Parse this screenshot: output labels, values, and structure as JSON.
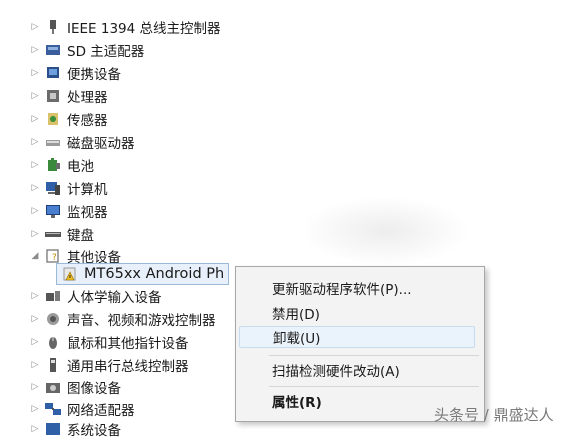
{
  "tree": {
    "items": [
      {
        "label": "IEEE 1394 总线主控制器",
        "icon": "ieee1394-icon"
      },
      {
        "label": "SD 主适配器",
        "icon": "sd-host-icon"
      },
      {
        "label": "便携设备",
        "icon": "portable-device-icon"
      },
      {
        "label": "处理器",
        "icon": "processor-icon"
      },
      {
        "label": "传感器",
        "icon": "sensor-icon"
      },
      {
        "label": "磁盘驱动器",
        "icon": "disk-drive-icon"
      },
      {
        "label": "电池",
        "icon": "battery-icon"
      },
      {
        "label": "计算机",
        "icon": "computer-icon"
      },
      {
        "label": "监视器",
        "icon": "monitor-icon"
      },
      {
        "label": "键盘",
        "icon": "keyboard-icon"
      },
      {
        "label": "其他设备",
        "icon": "other-devices-icon"
      },
      {
        "label": "人体学输入设备",
        "icon": "hid-icon"
      },
      {
        "label": "声音、视频和游戏控制器",
        "icon": "sound-icon"
      },
      {
        "label": "鼠标和其他指针设备",
        "icon": "mouse-icon"
      },
      {
        "label": "通用串行总线控制器",
        "icon": "usb-icon"
      },
      {
        "label": "图像设备",
        "icon": "imaging-icon"
      },
      {
        "label": "网络适配器",
        "icon": "network-icon"
      },
      {
        "label": "系统设备",
        "icon": "system-icon"
      }
    ],
    "selected_child": {
      "label": "MT65xx Android Ph",
      "icon": "warning-device-icon"
    }
  },
  "context_menu": {
    "update_driver": "更新驱动程序软件(P)...",
    "disable": "禁用(D)",
    "uninstall": "卸载(U)",
    "scan": "扫描检测硬件改动(A)",
    "properties": "属性(R)"
  },
  "watermark": "头条号 / 鼎盛达人"
}
